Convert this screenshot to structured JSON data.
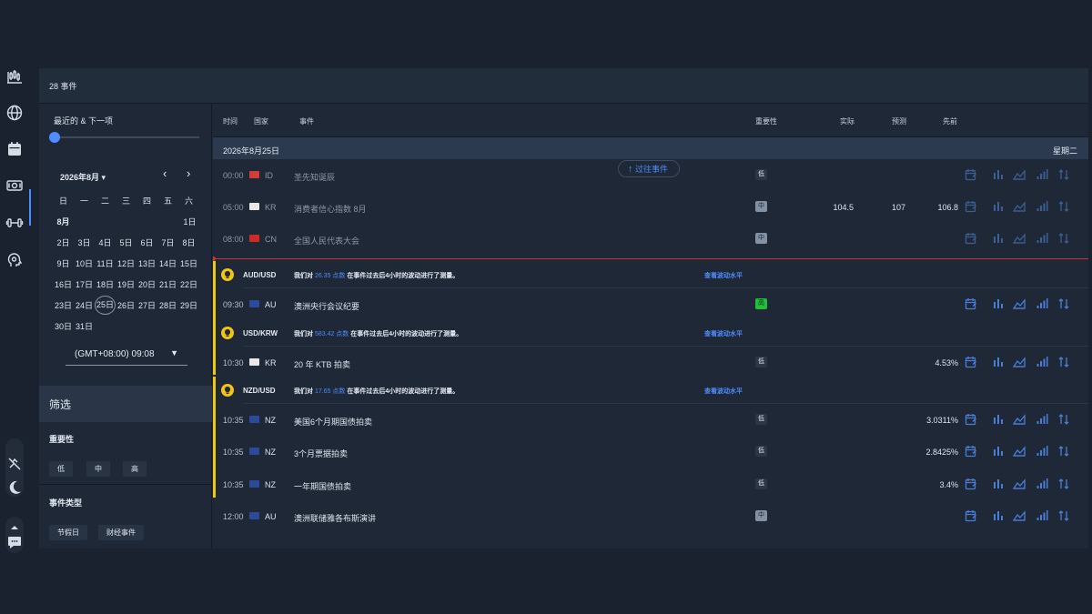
{
  "header": {
    "event_count": "28 事件"
  },
  "sidebar_rail": {
    "icons": [
      "candlestick-chart-icon",
      "globe-icon",
      "calendar-icon",
      "money-icon",
      "dumbbell-icon",
      "brain-icon"
    ],
    "bottom_icons": [
      "no-sound-icon",
      "moon-icon",
      "chevron-up-icon",
      "chat-icon"
    ]
  },
  "left_panel": {
    "recent_label": "最近的 & 下一项",
    "calendar": {
      "month_label": "2026年8月 ▾",
      "prev": "‹",
      "next": "›",
      "weekdays": [
        "日",
        "一",
        "二",
        "三",
        "四",
        "五",
        "六"
      ],
      "month_row": "8月",
      "first_day": "1日",
      "weeks": [
        [
          "2日",
          "3日",
          "4日",
          "5日",
          "6日",
          "7日",
          "8日"
        ],
        [
          "9日",
          "10日",
          "11日",
          "12日",
          "13日",
          "14日",
          "15日"
        ],
        [
          "16日",
          "17日",
          "18日",
          "19日",
          "20日",
          "21日",
          "22日"
        ],
        [
          "23日",
          "24日",
          "25日",
          "26日",
          "27日",
          "28日",
          "29日"
        ],
        [
          "30日",
          "31日",
          "",
          "",
          "",
          "",
          ""
        ]
      ]
    },
    "timezone": "(GMT+08:00) 09:08",
    "filter": {
      "title": "筛选",
      "importance_label": "重要性",
      "importance_chips": [
        "低",
        "中",
        "高"
      ],
      "event_type_label": "事件类型",
      "event_type_chips": [
        "节假日",
        "财经事件"
      ]
    }
  },
  "table": {
    "headers": {
      "time": "时间",
      "country": "国家",
      "event": "事件",
      "importance": "重要性",
      "actual": "实际",
      "forecast": "预测",
      "previous": "先前"
    },
    "date": "2026年8月25日",
    "weekday": "星期二",
    "past_events_button": "过往事件",
    "rows": [
      {
        "time": "00:00",
        "cc": "ID",
        "flag": "#d43b3b",
        "name": "圣先知诞辰",
        "imp": "低",
        "imp_class": "low",
        "actual": "",
        "forecast": "",
        "previous": ""
      },
      {
        "time": "05:00",
        "cc": "KR",
        "flag": "#e8e8e8",
        "name": "消费者信心指数 8月",
        "imp": "中",
        "imp_class": "mid",
        "actual": "104.5",
        "forecast": "107",
        "previous": "106.8"
      },
      {
        "time": "08:00",
        "cc": "CN",
        "flag": "#cf2a2a",
        "name": "全国人民代表大会",
        "imp": "中",
        "imp_class": "mid",
        "actual": "",
        "forecast": "",
        "previous": ""
      },
      {
        "time": "09:30",
        "cc": "AU",
        "flag": "#2c4a9a",
        "name": "澳洲央行会议纪要",
        "imp": "高",
        "imp_class": "high",
        "actual": "",
        "forecast": "",
        "previous": ""
      },
      {
        "time": "10:30",
        "cc": "KR",
        "flag": "#e8e8e8",
        "name": "20 年 KTB 拍卖",
        "imp": "低",
        "imp_class": "low",
        "actual": "",
        "forecast": "",
        "previous": "4.53%"
      },
      {
        "time": "10:35",
        "cc": "NZ",
        "flag": "#2c4a9a",
        "name": "美国6个月期国债拍卖",
        "imp": "低",
        "imp_class": "low",
        "actual": "",
        "forecast": "",
        "previous": "3.0311%"
      },
      {
        "time": "10:35",
        "cc": "NZ",
        "flag": "#2c4a9a",
        "name": "3个月票据拍卖",
        "imp": "低",
        "imp_class": "low",
        "actual": "",
        "forecast": "",
        "previous": "2.8425%"
      },
      {
        "time": "10:35",
        "cc": "NZ",
        "flag": "#2c4a9a",
        "name": "一年期国债拍卖",
        "imp": "低",
        "imp_class": "low",
        "actual": "",
        "forecast": "",
        "previous": "3.4%"
      },
      {
        "time": "12:00",
        "cc": "AU",
        "flag": "#2c4a9a",
        "name": "澳洲联储雅各布斯演讲",
        "imp": "中",
        "imp_class": "mid",
        "actual": "",
        "forecast": "",
        "previous": ""
      }
    ],
    "volatility": [
      {
        "pair": "AUD/USD",
        "pre": "我们对 ",
        "points": "26.35 点数",
        "post": " 在事件过去后4小时的波动进行了测量。",
        "link": "查看波动水平"
      },
      {
        "pair": "USD/KRW",
        "pre": "我们对 ",
        "points": "583.42 点数",
        "post": " 在事件过去后4小时的波动进行了测量。",
        "link": "查看波动水平"
      },
      {
        "pair": "NZD/USD",
        "pre": "我们对 ",
        "points": "17.65 点数",
        "post": " 在事件过去后4小时的波动进行了测量。",
        "link": "查看波动水平"
      }
    ],
    "row_action_icons": [
      "add-calendar-icon",
      "bar-chart-icon",
      "area-chart-icon",
      "signal-bars-icon",
      "sort-arrows-icon"
    ]
  },
  "colors": {
    "accent": "#4f8cff",
    "high": "#22c03a",
    "alert": "#f2c511",
    "now_line": "#c43636"
  }
}
